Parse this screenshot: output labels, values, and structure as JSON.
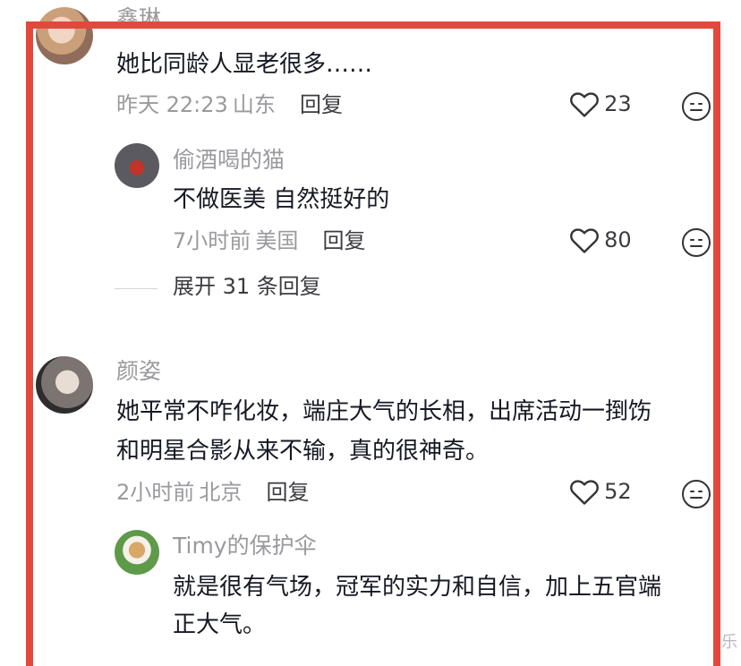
{
  "comments": [
    {
      "author": "鑫琳",
      "text": "她比同龄人显老很多……",
      "time": "昨天 22:23",
      "location": "山东",
      "reply_label": "回复",
      "likes": "23"
    },
    {
      "author": "偷酒喝的猫",
      "text": "不做医美 自然挺好的",
      "time": "7小时前",
      "location": "美国",
      "reply_label": "回复",
      "likes": "80"
    },
    {
      "author": "颜姿",
      "text_line1": "她平常不咋化妆，端庄大气的长相，出席活动一捯饬",
      "text_line2": "和明星合影从来不输，真的很神奇。",
      "time": "2小时前",
      "location": "北京",
      "reply_label": "回复",
      "likes": "52"
    },
    {
      "author": "Timy的保护伞",
      "text_line1": "就是很有气场，冠军的实力和自信，加上五官端",
      "text_line2": "正大气。"
    }
  ],
  "expand_replies": "展开 31 条回复",
  "edge_char": "乐",
  "colors": {
    "frame": "#e2493c",
    "muted": "#9a9a9e",
    "text": "#161823"
  },
  "icons": [
    "heart-icon",
    "emoji-face-icon"
  ]
}
